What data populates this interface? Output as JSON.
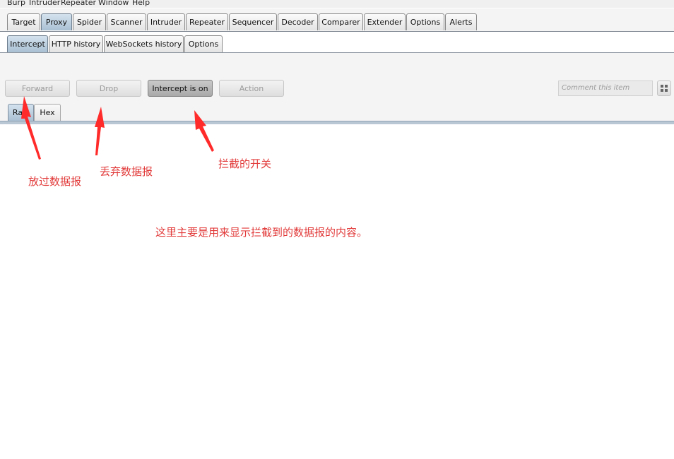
{
  "menu_bar": [
    "Burp",
    "Intruder",
    "Repeater",
    "Window",
    "Help"
  ],
  "main_tabs": {
    "items": [
      "Target",
      "Proxy",
      "Spider",
      "Scanner",
      "Intruder",
      "Repeater",
      "Sequencer",
      "Decoder",
      "Comparer",
      "Extender",
      "Options",
      "Alerts"
    ],
    "active": "Proxy"
  },
  "proxy_tabs": {
    "items": [
      "Intercept",
      "HTTP history",
      "WebSockets history",
      "Options"
    ],
    "active": "Intercept"
  },
  "toolbar": {
    "forward": "Forward",
    "drop": "Drop",
    "intercept": "Intercept is on",
    "action": "Action",
    "comment_placeholder": "Comment this item"
  },
  "view_tabs": {
    "items": [
      "Raw",
      "Hex"
    ],
    "active": "Raw"
  },
  "annotations": {
    "forward": "放过数据报",
    "drop": "丢弃数据报",
    "intercept": "拦截的开关",
    "content": "这里主要是用来显示拦截到的数据报的内容。"
  },
  "colors": {
    "annotation": "#e23a3a",
    "active_tab": "#a9c0d3"
  }
}
